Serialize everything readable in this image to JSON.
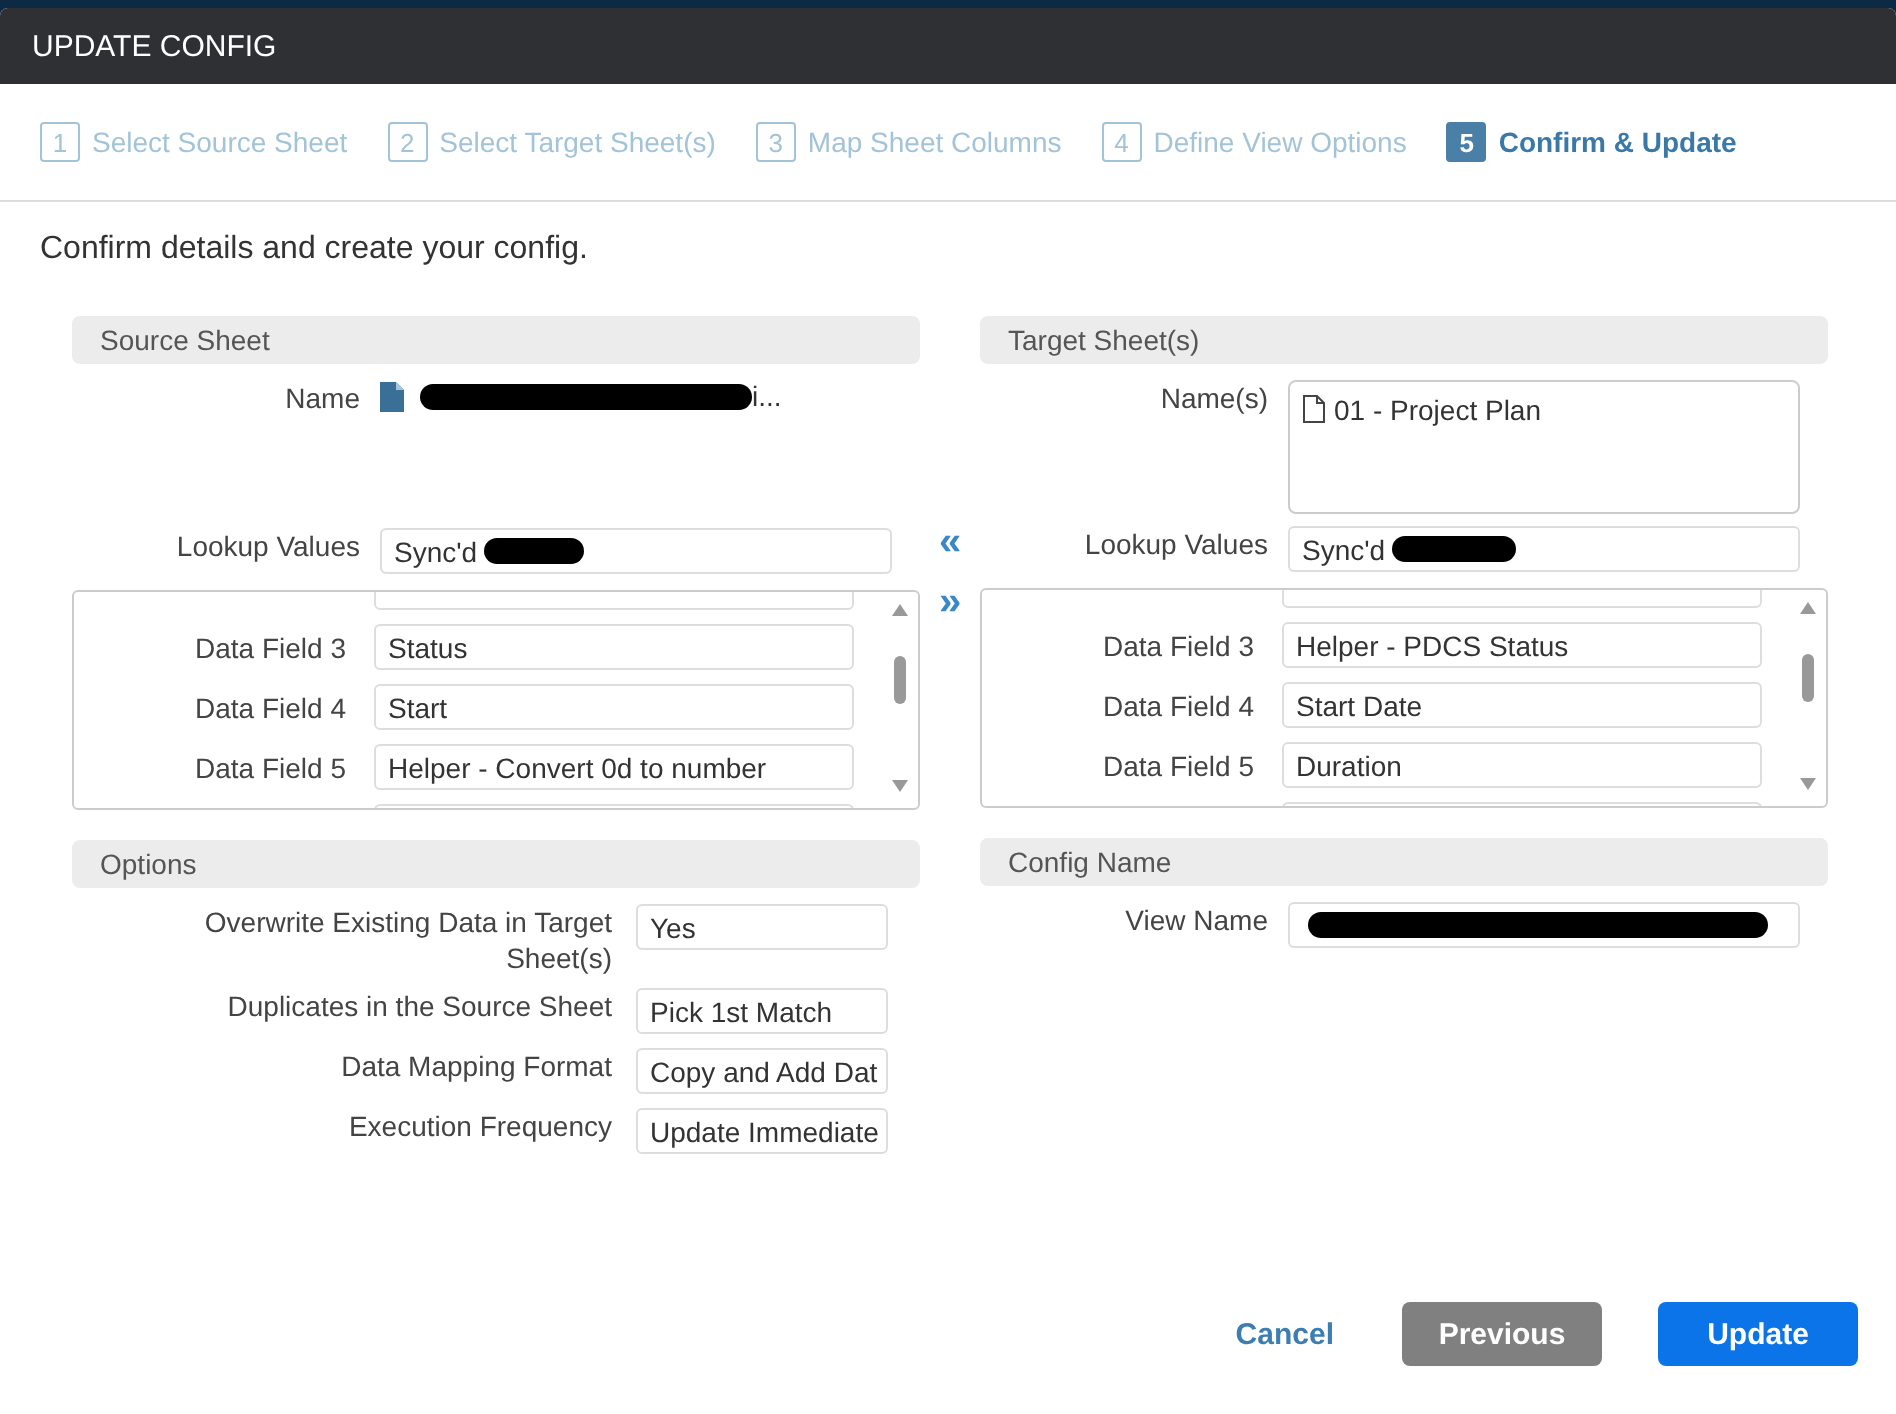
{
  "dialog": {
    "title": "UPDATE CONFIG"
  },
  "steps": [
    {
      "number": "1",
      "label": "Select Source Sheet",
      "selected": false
    },
    {
      "number": "2",
      "label": "Select Target Sheet(s)",
      "selected": false
    },
    {
      "number": "3",
      "label": "Map Sheet Columns",
      "selected": false
    },
    {
      "number": "4",
      "label": "Define View Options",
      "selected": false
    },
    {
      "number": "5",
      "label": "Confirm & Update",
      "selected": true
    }
  ],
  "intro": "Confirm details and create your config.",
  "source": {
    "header": "Source Sheet",
    "name_label": "Name",
    "name_value": "i...",
    "lookup_label": "Lookup Values",
    "lookup_value": "Sync'd",
    "fields": [
      {
        "label": "Data Field 3",
        "value": "Status"
      },
      {
        "label": "Data Field 4",
        "value": "Start"
      },
      {
        "label": "Data Field 5",
        "value": "Helper - Convert 0d to number"
      }
    ]
  },
  "arrows": [
    "«",
    "»"
  ],
  "target": {
    "header": "Target Sheet(s)",
    "name_label": "Name(s)",
    "names": [
      "01 - Project Plan"
    ],
    "lookup_label": "Lookup Values",
    "lookup_value": "Sync'd",
    "fields": [
      {
        "label": "Data Field 3",
        "value": "Helper - PDCS Status"
      },
      {
        "label": "Data Field 4",
        "value": "Start Date"
      },
      {
        "label": "Data Field 5",
        "value": "Duration"
      }
    ]
  },
  "options": {
    "header": "Options",
    "rows": [
      {
        "label": "Overwrite Existing Data in Target Sheet(s)",
        "value": "Yes"
      },
      {
        "label": "Duplicates in the Source Sheet",
        "value": "Pick 1st Match"
      },
      {
        "label": "Data Mapping Format",
        "value": "Copy and Add Dat"
      },
      {
        "label": "Execution Frequency",
        "value": "Update Immediate"
      }
    ]
  },
  "config": {
    "header": "Config Name",
    "view_label": "View Name"
  },
  "buttons": [
    {
      "label": "Cancel",
      "kind": "link"
    },
    {
      "label": "Previous",
      "kind": "secondary"
    },
    {
      "label": "Update",
      "kind": "primary"
    }
  ]
}
